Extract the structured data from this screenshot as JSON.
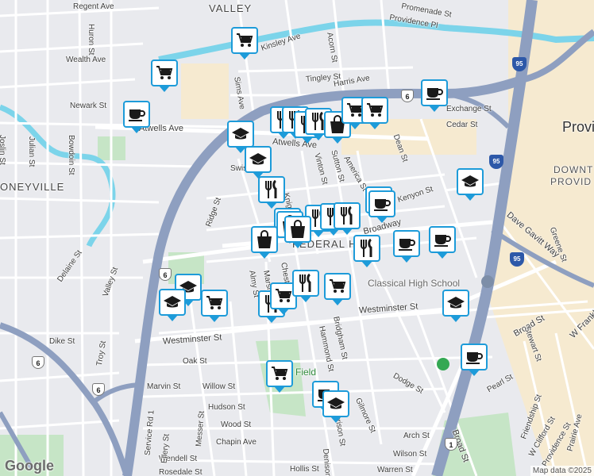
{
  "map": {
    "colors": {
      "pin_border": "#1d9bd9",
      "highway": "#8e9fc0",
      "water": "#7cd4ea",
      "park": "#c6e5c6",
      "downtown": "#f6ead0"
    },
    "street_labels": [
      "Regent Ave",
      "Huron St",
      "Kinsley Ave",
      "Promenade St",
      "Providence Pl",
      "Acorn St",
      "Tingley St",
      "Harris Ave",
      "Exchange St",
      "Cedar St",
      "Dean St",
      "Atwells Ave",
      "Newark St",
      "Wealth Ave",
      "Sims Ave",
      "Joslin St",
      "Julian St",
      "Bowdoin St",
      "Vinton St",
      "Sutton St",
      "America St",
      "Kenyon St",
      "Broadway",
      "Ridge St",
      "Delaine St",
      "Valley St",
      "Westminster St",
      "Dike St",
      "Troy St",
      "Oak St",
      "Marvin St",
      "Willow St",
      "Hudson St",
      "Wood St",
      "Chapin Ave",
      "Wendell St",
      "Hollis St",
      "Rosedale St",
      "Service Rd 1",
      "Ellery St",
      "Messer St",
      "Almy St",
      "Bridgham St",
      "Hammond St",
      "Gilmore St",
      "Dodge St",
      "Arch St",
      "Wilson St",
      "Warren St",
      "Broad St",
      "Stewart St",
      "Pearl St",
      "Friendship St",
      "W Clifford St",
      "Providence St",
      "Prairie Ave",
      "Dave Gavitt Way",
      "Greene St",
      "W Franklin",
      "Swiss St",
      "Knight St",
      "Chester Ave",
      "Marshall St",
      "Denison St",
      "Harrison St"
    ],
    "area_labels": [
      "VALLEY",
      "ONEYVILLE",
      "Provi",
      "DOWNT",
      "PROVID",
      "FEDERAL HILL",
      "Classical High School",
      "Field"
    ],
    "route_shields": [
      "6",
      "6",
      "6",
      "6",
      "95",
      "95",
      "95",
      "1"
    ],
    "pins": [
      {
        "icon": "grocery-icon"
      },
      {
        "icon": "grocery-icon"
      },
      {
        "icon": "coffee-icon"
      },
      {
        "icon": "coffee-icon"
      },
      {
        "icon": "restaurant-icon"
      },
      {
        "icon": "restaurant-icon"
      },
      {
        "icon": "restaurant-icon"
      },
      {
        "icon": "restaurant-icon"
      },
      {
        "icon": "shopping-bag-icon"
      },
      {
        "icon": "grocery-icon"
      },
      {
        "icon": "grocery-icon"
      },
      {
        "icon": "school-icon"
      },
      {
        "icon": "school-icon"
      },
      {
        "icon": "restaurant-icon"
      },
      {
        "icon": "coffee-icon"
      },
      {
        "icon": "school-icon"
      },
      {
        "icon": "restaurant-icon"
      },
      {
        "icon": "shopping-bag-icon"
      },
      {
        "icon": "restaurant-icon"
      },
      {
        "icon": "restaurant-icon"
      },
      {
        "icon": "restaurant-icon"
      },
      {
        "icon": "coffee-icon"
      },
      {
        "icon": "shopping-bag-icon"
      },
      {
        "icon": "shopping-bag-icon"
      },
      {
        "icon": "restaurant-icon"
      },
      {
        "icon": "coffee-icon"
      },
      {
        "icon": "coffee-icon"
      },
      {
        "icon": "school-icon"
      },
      {
        "icon": "school-icon"
      },
      {
        "icon": "grocery-icon"
      },
      {
        "icon": "restaurant-icon"
      },
      {
        "icon": "grocery-icon"
      },
      {
        "icon": "restaurant-icon"
      },
      {
        "icon": "grocery-icon"
      },
      {
        "icon": "school-icon"
      },
      {
        "icon": "coffee-icon"
      },
      {
        "icon": "grocery-icon"
      },
      {
        "icon": "coffee-icon"
      },
      {
        "icon": "school-icon"
      }
    ],
    "google_logo": "Google",
    "attribution": "Map data ©2025"
  }
}
